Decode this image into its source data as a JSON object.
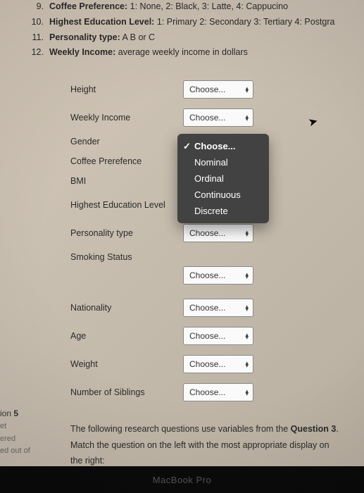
{
  "list": {
    "item9_num": "9.",
    "item9_label": "Coffee Preference:",
    "item9_desc": "1: None, 2: Black,  3: Latte,  4: Cappucino",
    "item10_num": "10.",
    "item10_label": "Highest Education Level:",
    "item10_desc": "1: Primary   2: Secondary   3: Tertiary   4: Postgra",
    "item11_num": "11.",
    "item11_label": "Personality type:",
    "item11_desc": "A    B  or  C",
    "item12_num": "12.",
    "item12_label": "Weekly Income:",
    "item12_desc": "average weekly income in dollars"
  },
  "form": {
    "rows": {
      "height": "Height",
      "weekly_income": "Weekly Income",
      "gender": "Gender",
      "coffee": "Coffee Prerefence",
      "bmi": "BMI",
      "edu": "Highest Education Level",
      "personality": "Personality type",
      "smoking": "Smoking Status",
      "nationality": "Nationality",
      "age": "Age",
      "weight": "Weight",
      "siblings": "Number of Siblings"
    },
    "placeholder": "Choose..."
  },
  "dropdown": {
    "opt0": "Choose...",
    "opt1": "Nominal",
    "opt2": "Ordinal",
    "opt3": "Continuous",
    "opt4": "Discrete"
  },
  "instructions": {
    "line1_a": "The following research questions use variables from the ",
    "line1_b": "Question 3",
    "line1_c": ".",
    "line2": "Match the question on the left with the most appropriate display on the right:"
  },
  "sidebar": {
    "q5_prefix": "ion ",
    "q5_num": "5",
    "et": "et",
    "ered": "ered",
    "ed_out_of": "ed out of"
  },
  "dock": "MacBook Pro"
}
